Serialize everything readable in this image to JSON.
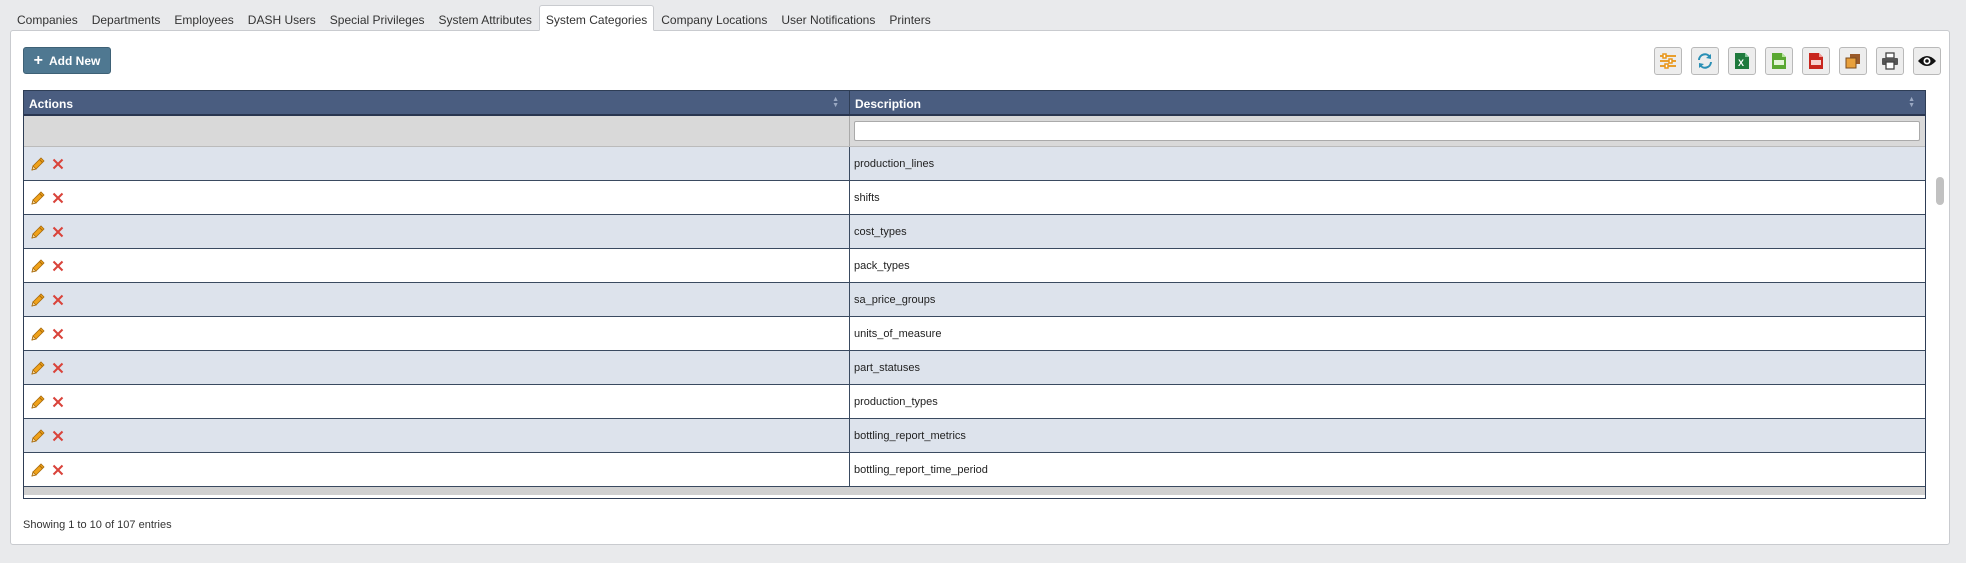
{
  "tabs": [
    {
      "label": "Companies",
      "active": false
    },
    {
      "label": "Departments",
      "active": false
    },
    {
      "label": "Employees",
      "active": false
    },
    {
      "label": "DASH Users",
      "active": false
    },
    {
      "label": "Special Privileges",
      "active": false
    },
    {
      "label": "System Attributes",
      "active": false
    },
    {
      "label": "System Categories",
      "active": true
    },
    {
      "label": "Company Locations",
      "active": false
    },
    {
      "label": "User Notifications",
      "active": false
    },
    {
      "label": "Printers",
      "active": false
    }
  ],
  "toolbar": {
    "add_new_label": "Add New",
    "tools": [
      "columns-settings-icon",
      "refresh-icon",
      "excel-export-icon",
      "csv-export-icon",
      "pdf-export-icon",
      "copy-icon",
      "print-icon",
      "view-icon"
    ]
  },
  "grid": {
    "columns": [
      "Actions",
      "Description"
    ],
    "filter_value": "",
    "rows": [
      "production_lines",
      "shifts",
      "cost_types",
      "pack_types",
      "sa_price_groups",
      "units_of_measure",
      "part_statuses",
      "production_types",
      "bottling_report_metrics",
      "bottling_report_time_period"
    ]
  },
  "footer": {
    "info": "Showing 1 to 10 of 107 entries"
  },
  "colors": {
    "header": "#4a5d80",
    "row_alt": "#dde3ec",
    "add_button": "#4f7891",
    "edit_icon": "#f0a21a",
    "delete_icon": "#d9433a"
  }
}
